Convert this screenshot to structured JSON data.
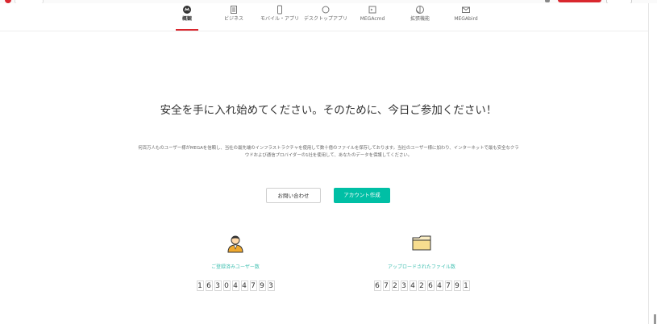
{
  "nav": {
    "items": [
      {
        "label": "概観",
        "icon": "overview-icon"
      },
      {
        "label": "ビジネス",
        "icon": "business-icon"
      },
      {
        "label": "モバイル・アプリ",
        "icon": "mobile-icon"
      },
      {
        "label": "デスクトップアプリ",
        "icon": "desktop-icon"
      },
      {
        "label": "MEGAcmd",
        "icon": "terminal-icon"
      },
      {
        "label": "拡張機能",
        "icon": "extension-icon"
      },
      {
        "label": "MEGAbird",
        "icon": "mail-icon"
      }
    ]
  },
  "hero": {
    "title": "安全を手に入れ始めてください。そのために、今日ご参加ください！",
    "description": "何百万人ものユーザー様がMEGAを信頼し、当社の最先端のインフラストラクチャを使用して数十億のファイルを保存しております。当社のユーザー様に加わり、インターネットで最も安全なクラウドおよび通信プロバイダーの1社を使用して、あなたのデータを保護してください。"
  },
  "buttons": {
    "contact": "お問い合わせ",
    "create_account": "アカウント作成"
  },
  "stats": {
    "users": {
      "label": "ご登録済みユーザー数",
      "digits": [
        "1",
        "6",
        "3",
        "0",
        "4",
        "4",
        "7",
        "9",
        "3"
      ]
    },
    "files": {
      "label": "アップロードされたファイル数",
      "digits": [
        "6",
        "7",
        "2",
        "3",
        "4",
        "2",
        "6",
        "4",
        "7",
        "9",
        "1"
      ]
    }
  },
  "colors": {
    "accent": "#00bfa5",
    "brand_red": "#d9272e",
    "stat_label": "#3fbfb0"
  }
}
